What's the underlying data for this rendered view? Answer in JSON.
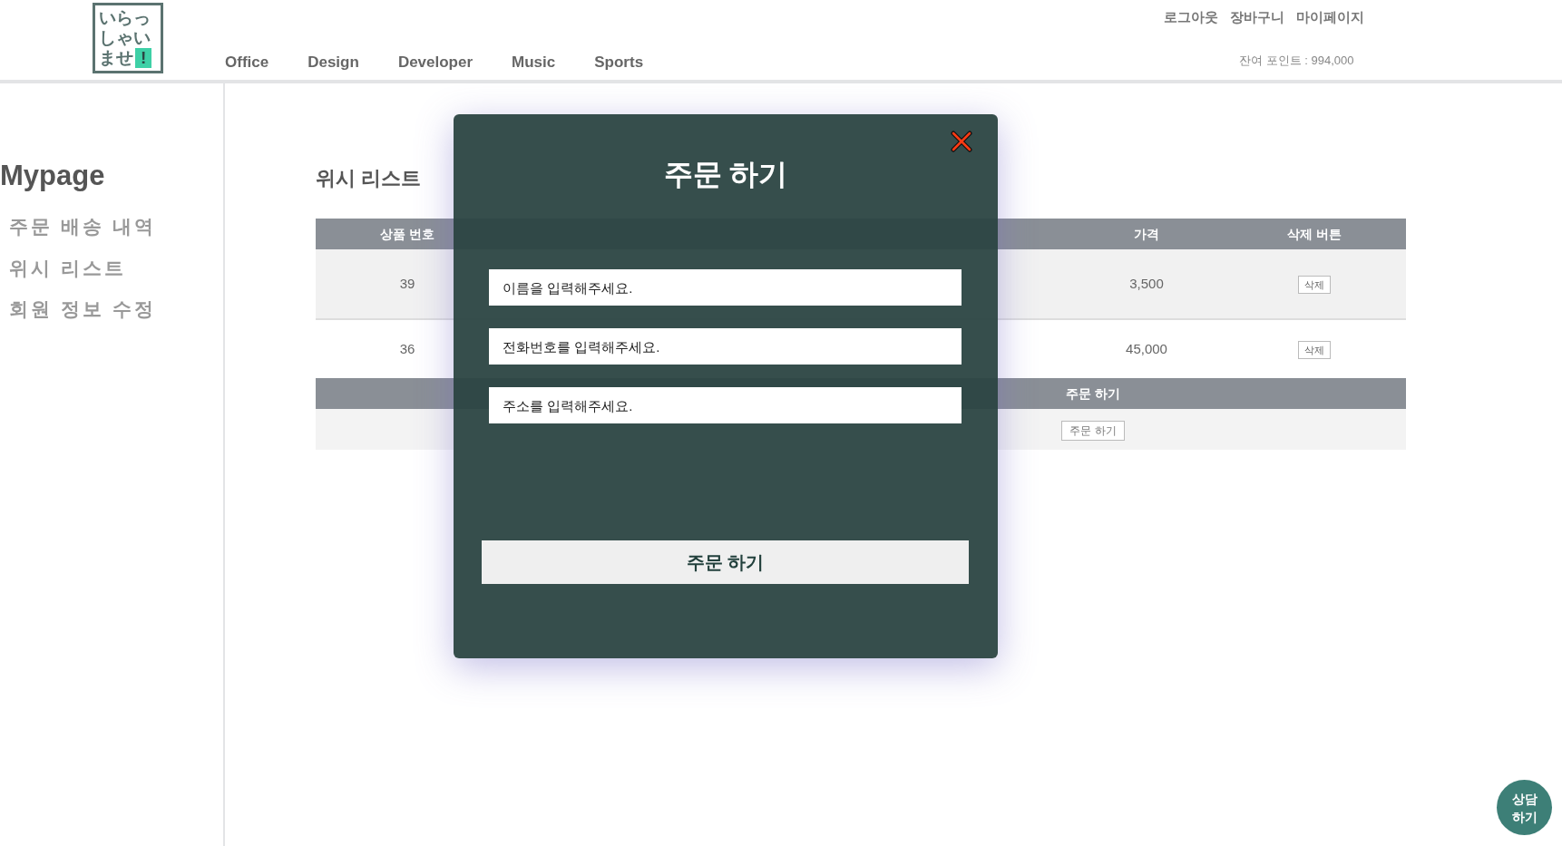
{
  "header": {
    "logo_lines": [
      "いらっ",
      "しゃい",
      "ませ"
    ],
    "logo_mark": "!",
    "nav": [
      "Office",
      "Design",
      "Developer",
      "Music",
      "Sports"
    ],
    "user_links": [
      "로그아웃",
      "장바구니",
      "마이페이지"
    ],
    "points": "잔여 포인트 : 994,000"
  },
  "sidebar": {
    "title": "Mypage",
    "items": [
      "주문 배송 내역",
      "위시 리스트",
      "회원 정보 수정"
    ]
  },
  "wishlist": {
    "title": "위시 리스트",
    "columns": [
      "상품 번호",
      "가격",
      "삭제 버튼"
    ],
    "rows": [
      {
        "number": "39",
        "price": "3,500",
        "action": "삭제"
      },
      {
        "number": "36",
        "price": "45,000",
        "action": "삭제"
      }
    ],
    "summary_column": "주문 하기",
    "summary_action": "주문 하기"
  },
  "modal": {
    "title": "주문 하기",
    "fields": [
      {
        "placeholder": "이름을 입력해주세요."
      },
      {
        "placeholder": "전화번호를 입력해주세요."
      },
      {
        "placeholder": "주소를 입력해주세요."
      }
    ],
    "submit": "주문 하기"
  },
  "chat_button": [
    "상담",
    "하기"
  ]
}
